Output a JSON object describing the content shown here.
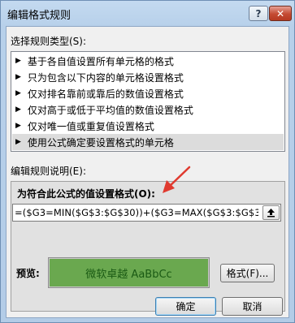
{
  "window": {
    "title": "编辑格式规则",
    "help_label": "?",
    "close_label": "✕"
  },
  "rule_type": {
    "label": "选择规则类型(S):",
    "items": [
      {
        "label": "基于各自值设置所有单元格的格式"
      },
      {
        "label": "只为包含以下内容的单元格设置格式"
      },
      {
        "label": "仅对排名靠前或靠后的数值设置格式"
      },
      {
        "label": "仅对高于或低于平均值的数值设置格式"
      },
      {
        "label": "仅对唯一值或重复值设置格式"
      },
      {
        "label": "使用公式确定要设置格式的单元格"
      }
    ],
    "selected_index": 5
  },
  "rule_desc": {
    "label": "编辑规则说明(E):",
    "formula_label": "为符合此公式的值设置格式(O):",
    "formula_value": "=($G3=MIN($G$3:$G$30))+($G3=MAX($G$3:$G$3"
  },
  "preview": {
    "label": "预览:",
    "sample_text": "微软卓越  AaBbCc",
    "fill_color": "#6aa84f"
  },
  "buttons": {
    "format": "格式(F)...",
    "ok": "确定",
    "cancel": "取消"
  },
  "icons": {
    "collapse": "collapse-dialog-icon",
    "rule_marker": "triangle-right-icon"
  },
  "colors": {
    "annotation_arrow": "#e03a2f"
  }
}
